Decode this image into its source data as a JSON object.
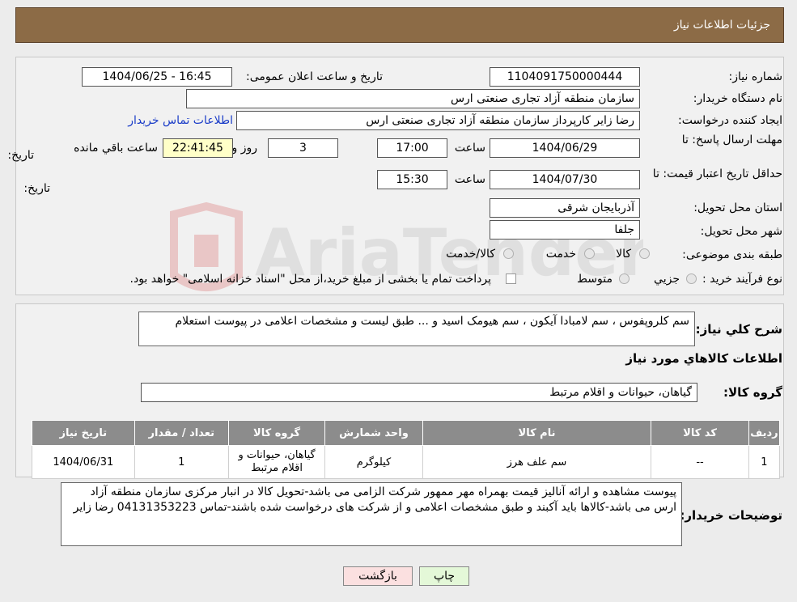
{
  "header": {
    "title": "جزئیات اطلاعات نیاز"
  },
  "form": {
    "need_number_label": "شماره نیاز:",
    "need_number": "1104091750000444",
    "announce_label": "تاریخ و ساعت اعلان عمومی:",
    "announce_value": "1404/06/25 - 16:45",
    "buyer_org_label": "نام دستگاه خریدار:",
    "buyer_org": "سازمان منطقه آزاد تجاری صنعتی ارس",
    "creator_label": "ایجاد کننده درخواست:",
    "creator": "رضا زاير كارپرداز سازمان منطقه آزاد تجاری صنعتی ارس",
    "contact_link": "اطلاعات تماس خریدار",
    "deadline_label_1": "مهلت ارسال پاسخ: تا",
    "deadline_label_2": "تاریخ:",
    "deadline_date": "1404/06/29",
    "time_label": "ساعت",
    "deadline_time": "17:00",
    "days_value": "3",
    "days_label": "روز و",
    "remaining_time": "22:41:45",
    "remaining_label": "ساعت باقي مانده",
    "validity_label_1": "حداقل تاریخ اعتبار قیمت: تا",
    "validity_label_2": "تاریخ:",
    "validity_date": "1404/07/30",
    "validity_time": "15:30",
    "province_label": "استان محل تحویل:",
    "province": "آذربایجان شرقی",
    "city_label": "شهر محل تحویل:",
    "city": "جلفا",
    "category_label": "طبقه بندی موضوعی:",
    "category_options": [
      "کالا",
      "خدمت",
      "کالا/خدمت"
    ],
    "process_label": "نوع فرآیند خرید :",
    "process_options": [
      "جزيي",
      "متوسط"
    ],
    "payment_note": "پرداخت تمام یا بخشی از مبلغ خرید،از محل \"اسناد خزانه اسلامی\" خواهد بود."
  },
  "description": {
    "label": "شرح كلي نياز:",
    "text": "سم کلروپفوس ، سم لامبادا آیکون ، سم هیومک اسید و ... طبق لیست و مشخصات اعلامی در پیوست استعلام"
  },
  "goods": {
    "section_title": "اطلاعات کالاهاي مورد نياز",
    "group_label": "گروه کالا:",
    "group_value": "گیاهان، حیوانات و اقلام مرتبط",
    "columns": [
      "رديف",
      "کد کالا",
      "نام کالا",
      "واحد شمارش",
      "گروه کالا",
      "تعداد / مقدار",
      "تاريخ نياز"
    ],
    "rows": [
      {
        "row": "1",
        "code": "--",
        "name": "سم علف هرز",
        "unit": "کیلوگرم",
        "group": "گیاهان، حیوانات و اقلام مرتبط",
        "qty": "1",
        "date": "1404/06/31"
      }
    ]
  },
  "buyer_notes": {
    "label": "توضيحات خريدار:",
    "text": "پیوست مشاهده و ارائه آنالیز قیمت بهمراه مهر ممهور شرکت الزامی می باشد-تحویل کالا در انبار مرکزی سازمان منطقه آزاد ارس می باشد-کالاها باید آکبند و طبق مشخصات اعلامی و از شرکت های درخواست شده باشند-تماس 04131353223 رضا زاير"
  },
  "buttons": {
    "print": "چاپ",
    "back": "بازگشت"
  },
  "colors": {
    "header_bg": "#8c6b46",
    "table_header": "#8c8c8c",
    "print_btn": "#e4f8d8",
    "back_btn": "#fbe0e0",
    "link": "#1a3cc8"
  }
}
